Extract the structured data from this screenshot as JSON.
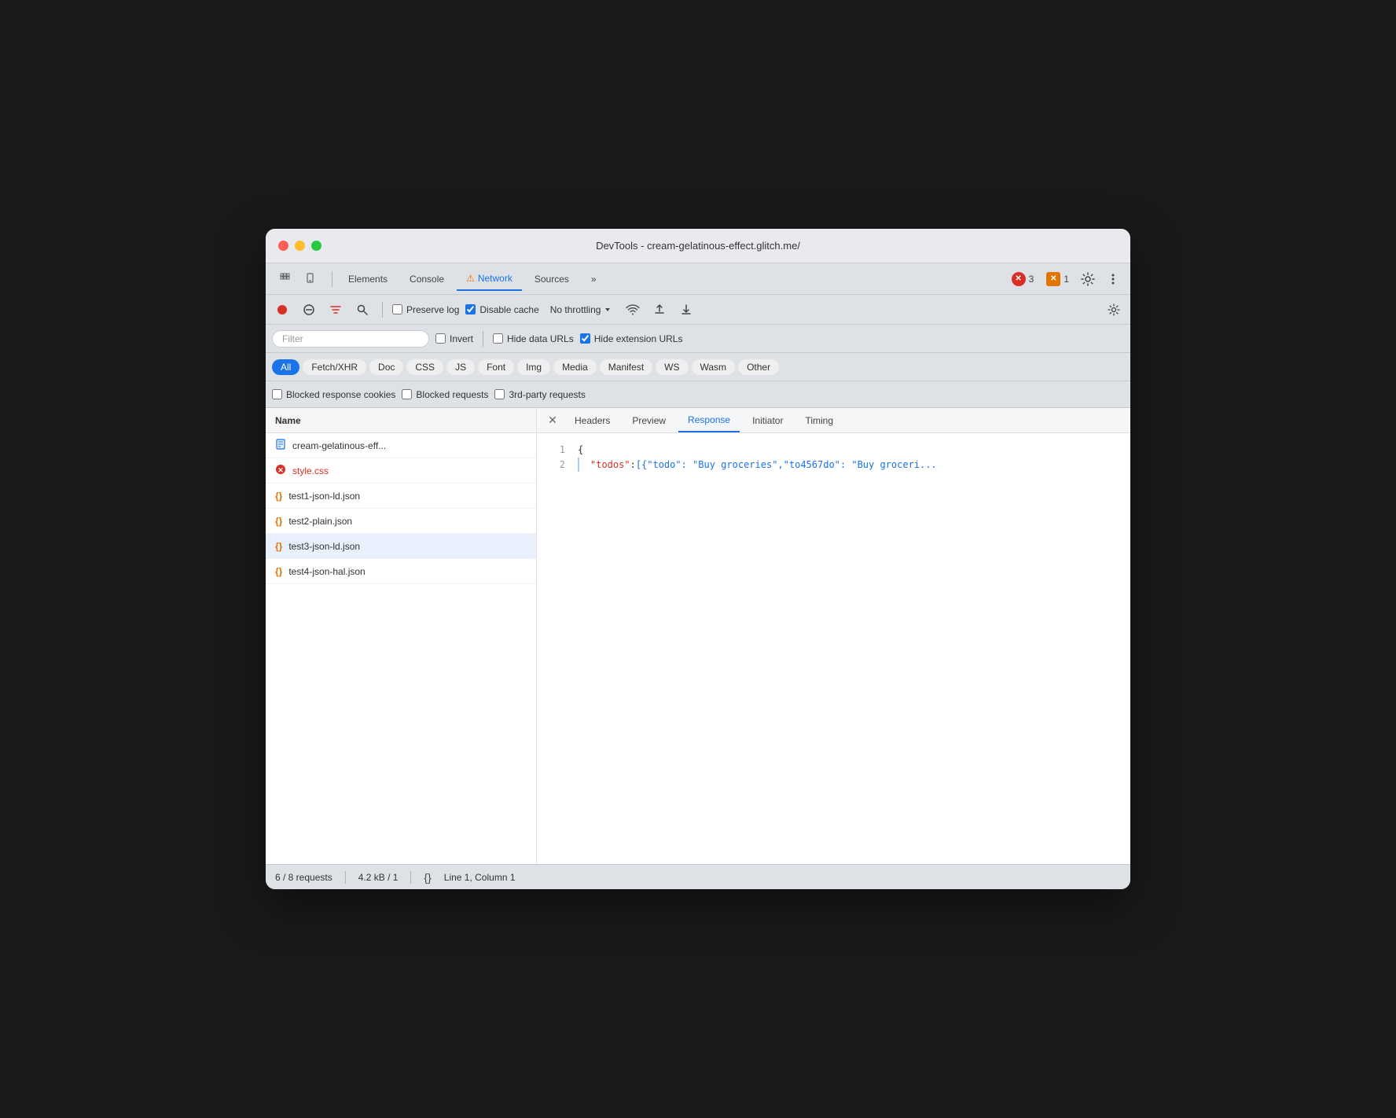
{
  "window": {
    "title": "DevTools - cream-gelatinous-effect.glitch.me/"
  },
  "tabs": {
    "items": [
      {
        "id": "cursor",
        "label": "⬡",
        "active": false
      },
      {
        "id": "device",
        "label": "⬡",
        "active": false
      },
      {
        "id": "elements",
        "label": "Elements",
        "active": false
      },
      {
        "id": "console",
        "label": "Console",
        "active": false
      },
      {
        "id": "network",
        "label": "Network",
        "active": true
      },
      {
        "id": "sources",
        "label": "Sources",
        "active": false
      },
      {
        "id": "more",
        "label": "»",
        "active": false
      }
    ],
    "error_count": "3",
    "warning_count": "1"
  },
  "toolbar": {
    "preserve_log": "Preserve log",
    "disable_cache": "Disable cache",
    "throttling": "No throttling",
    "filter_placeholder": "Filter",
    "invert_label": "Invert",
    "hide_data_urls": "Hide data URLs",
    "hide_extension_urls": "Hide extension URLs"
  },
  "type_filters": [
    {
      "id": "all",
      "label": "All",
      "active": true
    },
    {
      "id": "fetch",
      "label": "Fetch/XHR",
      "active": false
    },
    {
      "id": "doc",
      "label": "Doc",
      "active": false
    },
    {
      "id": "css",
      "label": "CSS",
      "active": false
    },
    {
      "id": "js",
      "label": "JS",
      "active": false
    },
    {
      "id": "font",
      "label": "Font",
      "active": false
    },
    {
      "id": "img",
      "label": "Img",
      "active": false
    },
    {
      "id": "media",
      "label": "Media",
      "active": false
    },
    {
      "id": "manifest",
      "label": "Manifest",
      "active": false
    },
    {
      "id": "ws",
      "label": "WS",
      "active": false
    },
    {
      "id": "wasm",
      "label": "Wasm",
      "active": false
    },
    {
      "id": "other",
      "label": "Other",
      "active": false
    }
  ],
  "extra_filters": {
    "blocked_response_cookies": "Blocked response cookies",
    "blocked_requests": "Blocked requests",
    "third_party": "3rd-party requests"
  },
  "file_list": {
    "header": "Name",
    "items": [
      {
        "id": "html",
        "name": "cream-gelatinous-eff...",
        "type": "doc",
        "error": false,
        "selected": false
      },
      {
        "id": "css",
        "name": "style.css",
        "type": "css",
        "error": true,
        "selected": false
      },
      {
        "id": "json1",
        "name": "test1-json-ld.json",
        "type": "json",
        "error": false,
        "selected": false
      },
      {
        "id": "json2",
        "name": "test2-plain.json",
        "type": "json",
        "error": false,
        "selected": false
      },
      {
        "id": "json3",
        "name": "test3-json-ld.json",
        "type": "json",
        "error": false,
        "selected": true
      },
      {
        "id": "json4",
        "name": "test4-json-hal.json",
        "type": "json",
        "error": false,
        "selected": false
      }
    ]
  },
  "response_panel": {
    "tabs": [
      {
        "id": "headers",
        "label": "Headers",
        "active": false
      },
      {
        "id": "preview",
        "label": "Preview",
        "active": false
      },
      {
        "id": "response",
        "label": "Response",
        "active": true
      },
      {
        "id": "initiator",
        "label": "Initiator",
        "active": false
      },
      {
        "id": "timing",
        "label": "Timing",
        "active": false
      }
    ],
    "content": {
      "line1": "{",
      "line2_key": "\"todos\"",
      "line2_value": "[{\"todo\": \"Buy groceries\",\"to4567do\": \"Buy groceri..."
    }
  },
  "status_bar": {
    "requests": "6 / 8 requests",
    "size": "4.2 kB / 1",
    "position": "Line 1, Column 1"
  }
}
